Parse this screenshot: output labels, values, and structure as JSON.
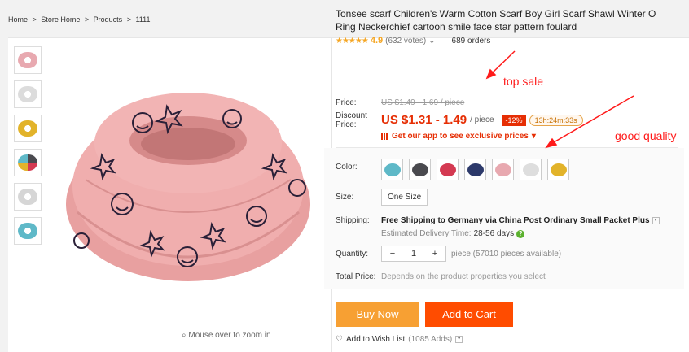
{
  "breadcrumb": [
    "Home",
    ">",
    "Store Home",
    ">",
    "Products",
    ">",
    "1111"
  ],
  "gallery": {
    "thumbnails": [
      "pink scarf",
      "white scarf",
      "yellow scarf",
      "multi color scarves",
      "white scarf",
      "teal scarf"
    ],
    "zoom_hint": "Mouse over to zoom in"
  },
  "product": {
    "title": "Tonsee scarf Children's Warm Cotton Scarf Boy Girl Scarf Shawl Winter O Ring Neckerchief cartoon smile face star pattern foulard",
    "stars": "★★★★★",
    "rating": "4.9",
    "votes": "(632 votes)",
    "orders": "689 orders"
  },
  "price": {
    "label": "Price:",
    "original": "US $1.49 - 1.69 / piece",
    "discount_label_1": "Discount",
    "discount_label_2": "Price:",
    "current": "US $1.31 - 1.49",
    "unit": "/ piece",
    "discount_badge": "-12%",
    "timer": "13h:24m:33s",
    "app_promo": "Get our app to see exclusive prices"
  },
  "options": {
    "color_label": "Color:",
    "colors": [
      "#5fb9c8",
      "#4a4a4f",
      "#d43a52",
      "#2d3a6b",
      "#e8a9b0",
      "#dedede",
      "#e2b32a"
    ],
    "size_label": "Size:",
    "size": "One Size",
    "shipping_label": "Shipping:",
    "shipping_main": "Free Shipping to Germany via China Post Ordinary Small Packet Plus",
    "delivery_label": "Estimated Delivery Time:",
    "delivery_days": "28-56  days",
    "quantity_label": "Quantity:",
    "qty_minus": "−",
    "qty_value": "1",
    "qty_plus": "+",
    "pieces_available": "piece (57010 pieces available)",
    "total_label": "Total Price:",
    "total_note": "Depends on the product properties you select"
  },
  "actions": {
    "buy_now": "Buy Now",
    "add_to_cart": "Add to Cart",
    "wishlist": "Add to Wish List",
    "wishlist_count": "(1085 Adds)"
  },
  "annotations": {
    "top_sale": "top sale",
    "good_quality": "good quality"
  },
  "colors": {
    "accent_red": "#e62e04",
    "buy_orange": "#f7a033",
    "cart_orange": "#ff4c00",
    "star_gold": "#f5a623"
  }
}
